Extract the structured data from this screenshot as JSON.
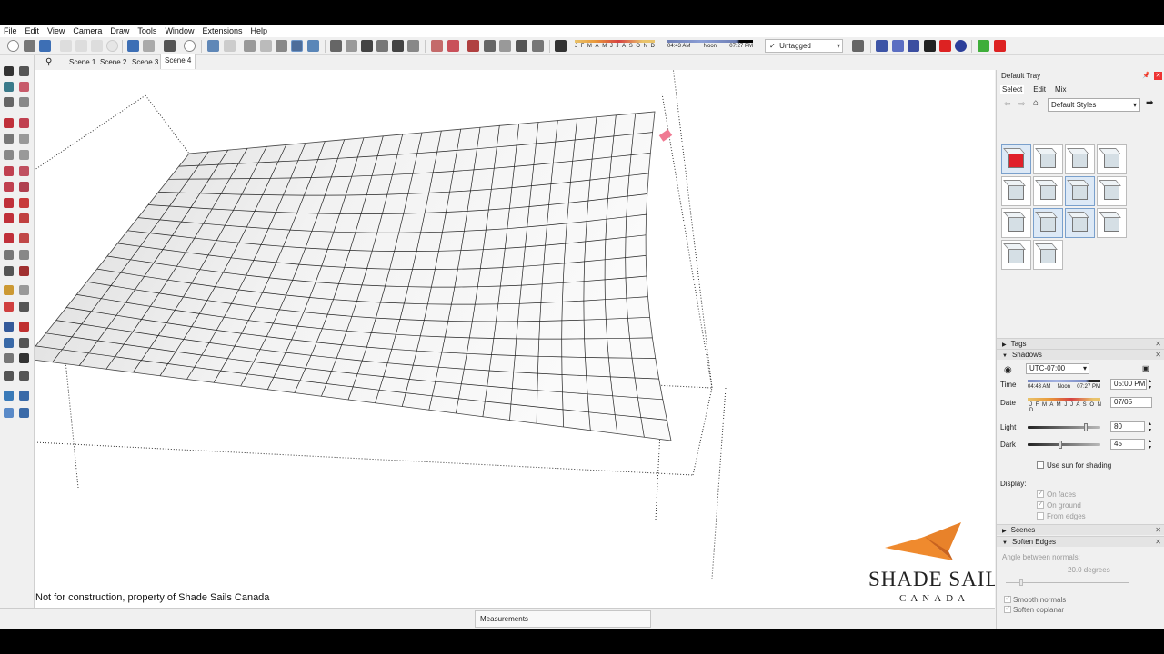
{
  "menu": [
    "File",
    "Edit",
    "View",
    "Camera",
    "Draw",
    "Tools",
    "Window",
    "Extensions",
    "Help"
  ],
  "toolbar": {
    "months": [
      "J",
      "F",
      "M",
      "A",
      "M",
      "J",
      "J",
      "A",
      "S",
      "O",
      "N",
      "D"
    ],
    "sunrise": "04:43 AM",
    "noon": "Noon",
    "sunset": "07:27 PM",
    "tag_value": "Untagged",
    "tag_check": "✓"
  },
  "scenes": {
    "tabs": [
      "Scene 1",
      "Scene 2",
      "Scene 3",
      "Scene 4"
    ],
    "active": "Scene 4"
  },
  "viewport": {
    "footnote": "Not for construction, property of Shade Sails Canada",
    "logo_main": "SHADE SAILS",
    "logo_sub": "CANADA",
    "brand_color": "#e8822a"
  },
  "status": {
    "measurements_label": "Measurements"
  },
  "tray": {
    "title": "Default Tray",
    "styles": {
      "tabs": [
        "Select",
        "Edit",
        "Mix"
      ],
      "collection": "Default Styles"
    },
    "sections": {
      "tags": "Tags",
      "shadows": "Shadows",
      "scenes": "Scenes",
      "soften": "Soften Edges"
    },
    "shadows": {
      "timezone": "UTC-07:00",
      "time_label": "Time",
      "time_value": "05:00 PM",
      "sunrise": "04:43 AM",
      "noon": "Noon",
      "sunset": "07:27 PM",
      "date_label": "Date",
      "date_value": "07/05",
      "months": "J F M A M J J A S O N D",
      "light_label": "Light",
      "light_value": "80",
      "light_level": 0.8,
      "dark_label": "Dark",
      "dark_value": "45",
      "dark_level": 0.45,
      "use_sun": "Use sun for shading",
      "display_label": "Display:",
      "on_faces": "On faces",
      "on_ground": "On ground",
      "from_edges": "From edges"
    },
    "soften": {
      "angle_label": "Angle between normals:",
      "angle_value": "20.0  degrees",
      "smooth_normals": "Smooth normals",
      "soften_coplanar": "Soften coplanar"
    }
  }
}
